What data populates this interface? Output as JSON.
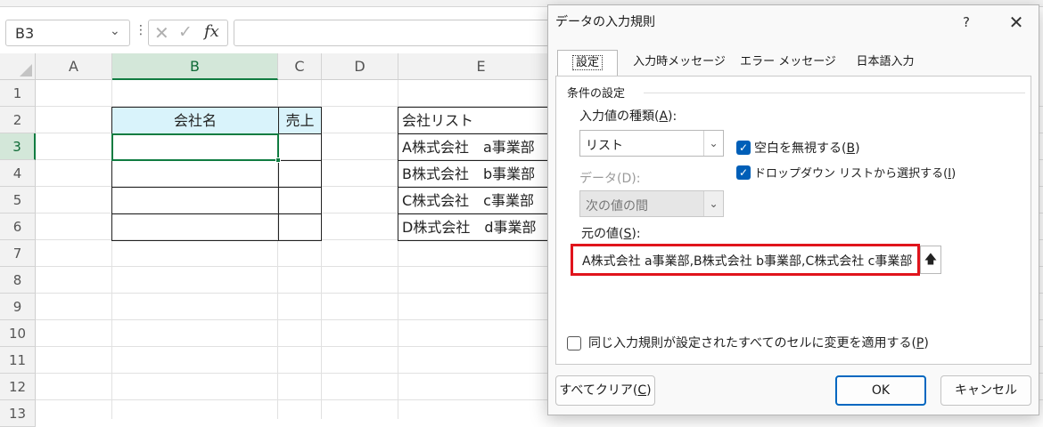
{
  "formula_bar": {
    "name_box": "B3",
    "fx": "fx"
  },
  "columns": [
    "A",
    "B",
    "C",
    "D",
    "E"
  ],
  "rows": [
    "1",
    "2",
    "3",
    "4",
    "5",
    "6",
    "7",
    "8",
    "9",
    "10",
    "11",
    "12",
    "13"
  ],
  "sheet": {
    "table_headers": [
      "会社名",
      "売上"
    ],
    "company_list_header": "会社リスト",
    "company_list": [
      "A株式会社　a事業部",
      "B株式会社　b事業部",
      "C株式会社　c事業部",
      "D株式会社　d事業部"
    ]
  },
  "dialog": {
    "title": "データの入力規則",
    "help": "?",
    "close": "✕",
    "tabs": [
      "設定",
      "入力時メッセージ",
      "エラー メッセージ",
      "日本語入力"
    ],
    "criteria_legend": "条件の設定",
    "type_label": "入力値の種類(",
    "type_accel": "A",
    "type_label_end": "):",
    "type_value": "リスト",
    "ignore_blank_label": "空白を無視する(",
    "ignore_blank_accel": "B",
    "ignore_blank_end": ")",
    "ignore_blank_checked": true,
    "dropdown_label": "ドロップダウン リストから選択する(",
    "dropdown_accel": "I",
    "dropdown_end": ")",
    "dropdown_checked": true,
    "data_label": "データ(D):",
    "data_value": "次の値の間",
    "source_label": "元の値(",
    "source_accel": "S",
    "source_label_end": "):",
    "source_value": "A株式会社  a事業部,B株式会社 b事業部,C株式会社 c事業部,D株式会社 d事業部",
    "apply_all_label": "同じ入力規則が設定されたすべてのセルに変更を適用する(",
    "apply_all_accel": "P",
    "apply_all_end": ")",
    "apply_all_checked": false,
    "clear_all_label": "すべてクリア(",
    "clear_all_accel": "C",
    "clear_all_end": ")",
    "ok_label": "OK",
    "cancel_label": "キャンセル"
  },
  "colors": {
    "accent_green": "#107c41",
    "header_fill": "#d9f3fb",
    "highlight_red": "#e0141c",
    "ok_blue": "#0067c0"
  }
}
